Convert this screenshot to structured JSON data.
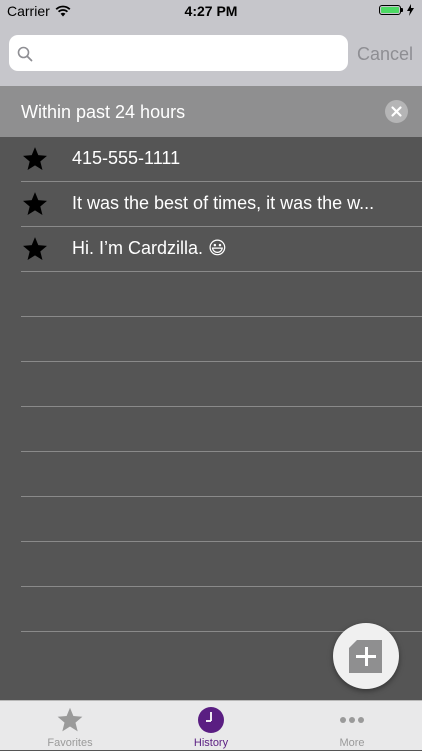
{
  "status_bar": {
    "carrier": "Carrier",
    "time": "4:27 PM"
  },
  "search": {
    "value": "",
    "placeholder": "",
    "cancel_label": "Cancel"
  },
  "section": {
    "title": "Within past 24 hours"
  },
  "history_items": [
    {
      "text": "415-555-1111",
      "favorite": true
    },
    {
      "text": "It was the best of times, it was the w...",
      "favorite": true
    },
    {
      "text": "Hi. I’m Cardzilla. 😃",
      "favorite": true
    }
  ],
  "tabs": [
    {
      "label": "Favorites",
      "icon": "star-icon",
      "selected": false
    },
    {
      "label": "History",
      "icon": "clock-icon",
      "selected": true
    },
    {
      "label": "More",
      "icon": "more-dots-icon",
      "selected": false
    }
  ],
  "colors": {
    "accent": "#5a1e82",
    "tab_inactive": "#9a9a9a",
    "list_background": "#555555",
    "header_background": "#8f8f90"
  }
}
